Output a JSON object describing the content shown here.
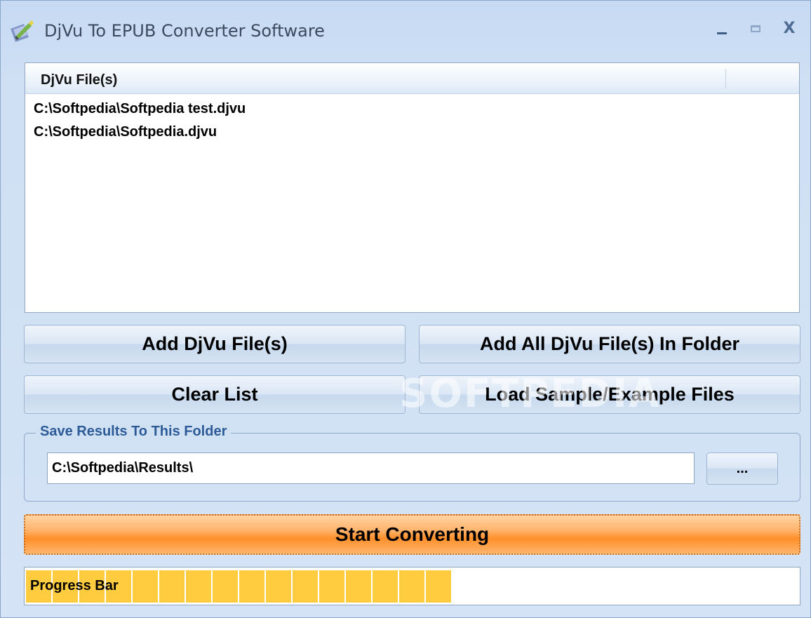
{
  "window": {
    "title": "DjVu To EPUB Converter Software",
    "controls": {
      "minimize": "minimize-icon",
      "maximize": "maximize-icon",
      "close": "close-icon"
    }
  },
  "file_list": {
    "column_header": "DjVu File(s)",
    "rows": [
      "C:\\Softpedia\\Softpedia test.djvu",
      "C:\\Softpedia\\Softpedia.djvu"
    ]
  },
  "buttons": {
    "add_files": "Add DjVu File(s)",
    "add_folder": "Add All DjVu File(s) In Folder",
    "clear_list": "Clear List",
    "load_samples": "Load Sample/Example Files",
    "browse": "...",
    "start": "Start Converting"
  },
  "output": {
    "group_title": "Save Results To This Folder",
    "folder_path": "C:\\Softpedia\\Results\\"
  },
  "progress": {
    "label": "Progress Bar",
    "filled_segments": 16,
    "fraction": 0.52
  },
  "watermark": "SOFTPEDIA",
  "colors": {
    "window_bg": "#cfe0f4",
    "start_button": "#ff9a3a",
    "progress_fill": "#ffcc3f",
    "group_title": "#2d5b97"
  }
}
